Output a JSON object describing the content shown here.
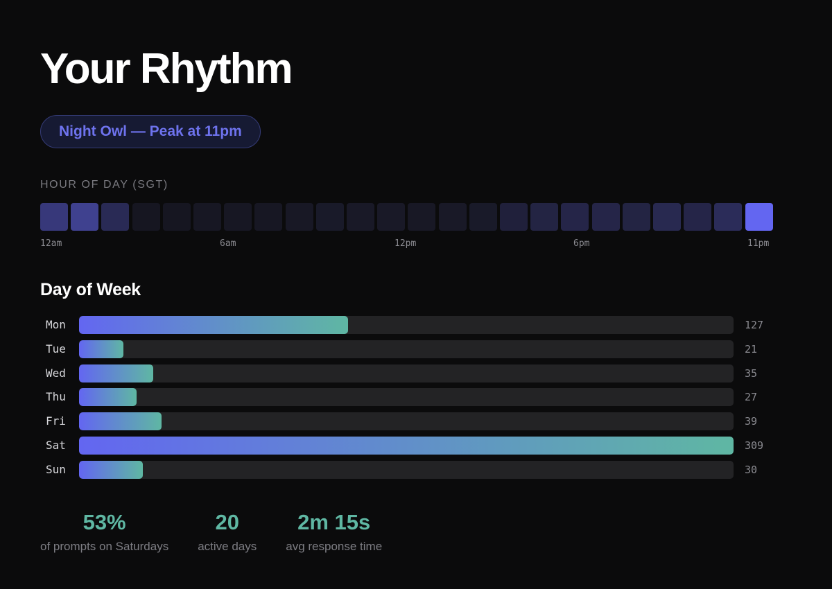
{
  "title": "Your Rhythm",
  "badge": "Night Owl — Peak at 11pm",
  "hour_section": {
    "label": "HOUR OF DAY (SGT)",
    "tick_labels": [
      "12am",
      "6am",
      "12pm",
      "6pm",
      "11pm"
    ]
  },
  "day_section": {
    "title": "Day of Week"
  },
  "chart_data": [
    {
      "type": "heatmap",
      "title": "HOUR OF DAY (SGT)",
      "x": [
        "12am",
        "1am",
        "2am",
        "3am",
        "4am",
        "5am",
        "6am",
        "7am",
        "8am",
        "9am",
        "10am",
        "11am",
        "12pm",
        "1pm",
        "2pm",
        "3pm",
        "4pm",
        "5pm",
        "6pm",
        "7pm",
        "8pm",
        "9pm",
        "10pm",
        "11pm"
      ],
      "intensity": [
        0.45,
        0.55,
        0.28,
        0.04,
        0.04,
        0.05,
        0.05,
        0.05,
        0.06,
        0.08,
        0.07,
        0.07,
        0.06,
        0.07,
        0.08,
        0.16,
        0.2,
        0.22,
        0.22,
        0.2,
        0.26,
        0.22,
        0.3,
        1.0
      ],
      "tick_labels": [
        "12am",
        "6am",
        "12pm",
        "6pm",
        "11pm"
      ],
      "peak": "11pm"
    },
    {
      "type": "bar",
      "orientation": "horizontal",
      "title": "Day of Week",
      "categories": [
        "Mon",
        "Tue",
        "Wed",
        "Thu",
        "Fri",
        "Sat",
        "Sun"
      ],
      "values": [
        127,
        21,
        35,
        27,
        39,
        309,
        30
      ],
      "value_labels": [
        "127",
        "21",
        "35",
        "27",
        "39",
        "309",
        "30"
      ],
      "xlim": [
        0,
        309
      ],
      "grid": false
    }
  ],
  "stats": [
    {
      "value": "53%",
      "label": "of prompts on Saturdays"
    },
    {
      "value": "20",
      "label": "active days"
    },
    {
      "value": "2m 15s",
      "label": "avg response time"
    }
  ],
  "colors": {
    "background": "#0b0b0c",
    "accent_purple": "#6366f1",
    "accent_teal": "#5fb7a3",
    "track": "#232325",
    "badge_text": "#6e73ee"
  }
}
